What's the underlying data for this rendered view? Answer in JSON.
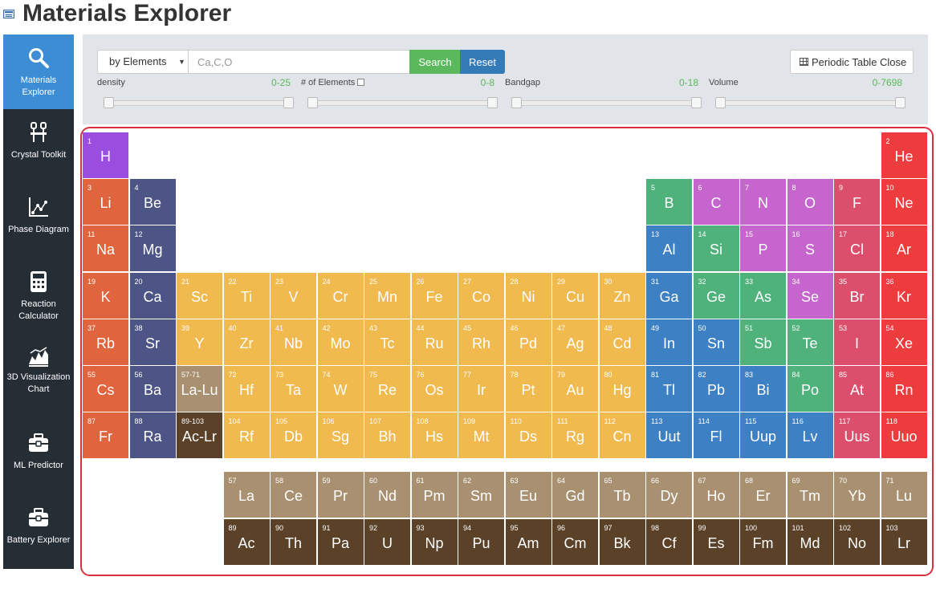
{
  "header": {
    "title": "Materials Explorer"
  },
  "sidebar": {
    "items": [
      {
        "label": "Materials Explorer",
        "icon": "search-icon",
        "active": true
      },
      {
        "label": "Crystal Toolkit",
        "icon": "toolkit-icon"
      },
      {
        "label": "Phase Diagram",
        "icon": "phase-diagram-icon"
      },
      {
        "label": "Reaction Calculator",
        "icon": "calculator-icon"
      },
      {
        "label": "3D Visualization Chart",
        "icon": "3d-chart-icon"
      },
      {
        "label": "ML Predictor",
        "icon": "toolbox-icon"
      },
      {
        "label": "Battery Explorer",
        "icon": "battery-toolbox-icon"
      }
    ]
  },
  "search": {
    "mode": "by Elements",
    "placeholder": "Ca,C,O",
    "value": "",
    "search_label": "Search",
    "reset_label": "Reset",
    "toggle_label": "Periodic Table Close"
  },
  "filters": [
    {
      "label": "density",
      "range": "0-25"
    },
    {
      "label": "# of Elements",
      "range": "0-8",
      "checkbox": true
    },
    {
      "label": "Bandgap",
      "range": "0-18"
    },
    {
      "label": "Volume",
      "range": "0-7698"
    }
  ],
  "colors": {
    "alkali": "#e0643e",
    "alkaline": "#4d5586",
    "transition": "#f0ba4f",
    "post_transition": "#3d80c4",
    "metalloid": "#4fb27b",
    "nonmetal": "#c665cd",
    "halogen": "#dc4f6c",
    "noble": "#ec3c3d",
    "hydrogen": "#9b4de0",
    "lanthanide": "#a99071",
    "actinide": "#5a4128"
  },
  "periodic_table": [
    {
      "n": "1",
      "s": "H",
      "c": "hydrogen",
      "r": 0,
      "k": 0
    },
    {
      "n": "2",
      "s": "He",
      "c": "noble",
      "r": 0,
      "k": 17
    },
    {
      "n": "3",
      "s": "Li",
      "c": "alkali",
      "r": 1,
      "k": 0
    },
    {
      "n": "4",
      "s": "Be",
      "c": "alkaline",
      "r": 1,
      "k": 1
    },
    {
      "n": "5",
      "s": "B",
      "c": "metalloid",
      "r": 1,
      "k": 12
    },
    {
      "n": "6",
      "s": "C",
      "c": "nonmetal",
      "r": 1,
      "k": 13
    },
    {
      "n": "7",
      "s": "N",
      "c": "nonmetal",
      "r": 1,
      "k": 14
    },
    {
      "n": "8",
      "s": "O",
      "c": "nonmetal",
      "r": 1,
      "k": 15
    },
    {
      "n": "9",
      "s": "F",
      "c": "halogen",
      "r": 1,
      "k": 16
    },
    {
      "n": "10",
      "s": "Ne",
      "c": "noble",
      "r": 1,
      "k": 17
    },
    {
      "n": "11",
      "s": "Na",
      "c": "alkali",
      "r": 2,
      "k": 0
    },
    {
      "n": "12",
      "s": "Mg",
      "c": "alkaline",
      "r": 2,
      "k": 1
    },
    {
      "n": "13",
      "s": "Al",
      "c": "post_transition",
      "r": 2,
      "k": 12
    },
    {
      "n": "14",
      "s": "Si",
      "c": "metalloid",
      "r": 2,
      "k": 13
    },
    {
      "n": "15",
      "s": "P",
      "c": "nonmetal",
      "r": 2,
      "k": 14
    },
    {
      "n": "16",
      "s": "S",
      "c": "nonmetal",
      "r": 2,
      "k": 15
    },
    {
      "n": "17",
      "s": "Cl",
      "c": "halogen",
      "r": 2,
      "k": 16
    },
    {
      "n": "18",
      "s": "Ar",
      "c": "noble",
      "r": 2,
      "k": 17
    },
    {
      "n": "19",
      "s": "K",
      "c": "alkali",
      "r": 3,
      "k": 0
    },
    {
      "n": "20",
      "s": "Ca",
      "c": "alkaline",
      "r": 3,
      "k": 1
    },
    {
      "n": "21",
      "s": "Sc",
      "c": "transition",
      "r": 3,
      "k": 2
    },
    {
      "n": "22",
      "s": "Ti",
      "c": "transition",
      "r": 3,
      "k": 3
    },
    {
      "n": "23",
      "s": "V",
      "c": "transition",
      "r": 3,
      "k": 4
    },
    {
      "n": "24",
      "s": "Cr",
      "c": "transition",
      "r": 3,
      "k": 5
    },
    {
      "n": "25",
      "s": "Mn",
      "c": "transition",
      "r": 3,
      "k": 6
    },
    {
      "n": "26",
      "s": "Fe",
      "c": "transition",
      "r": 3,
      "k": 7
    },
    {
      "n": "27",
      "s": "Co",
      "c": "transition",
      "r": 3,
      "k": 8
    },
    {
      "n": "28",
      "s": "Ni",
      "c": "transition",
      "r": 3,
      "k": 9
    },
    {
      "n": "29",
      "s": "Cu",
      "c": "transition",
      "r": 3,
      "k": 10
    },
    {
      "n": "30",
      "s": "Zn",
      "c": "transition",
      "r": 3,
      "k": 11
    },
    {
      "n": "31",
      "s": "Ga",
      "c": "post_transition",
      "r": 3,
      "k": 12
    },
    {
      "n": "32",
      "s": "Ge",
      "c": "metalloid",
      "r": 3,
      "k": 13
    },
    {
      "n": "33",
      "s": "As",
      "c": "metalloid",
      "r": 3,
      "k": 14
    },
    {
      "n": "34",
      "s": "Se",
      "c": "nonmetal",
      "r": 3,
      "k": 15
    },
    {
      "n": "35",
      "s": "Br",
      "c": "halogen",
      "r": 3,
      "k": 16
    },
    {
      "n": "36",
      "s": "Kr",
      "c": "noble",
      "r": 3,
      "k": 17
    },
    {
      "n": "37",
      "s": "Rb",
      "c": "alkali",
      "r": 4,
      "k": 0
    },
    {
      "n": "38",
      "s": "Sr",
      "c": "alkaline",
      "r": 4,
      "k": 1
    },
    {
      "n": "39",
      "s": "Y",
      "c": "transition",
      "r": 4,
      "k": 2
    },
    {
      "n": "40",
      "s": "Zr",
      "c": "transition",
      "r": 4,
      "k": 3
    },
    {
      "n": "41",
      "s": "Nb",
      "c": "transition",
      "r": 4,
      "k": 4
    },
    {
      "n": "42",
      "s": "Mo",
      "c": "transition",
      "r": 4,
      "k": 5
    },
    {
      "n": "43",
      "s": "Tc",
      "c": "transition",
      "r": 4,
      "k": 6
    },
    {
      "n": "44",
      "s": "Ru",
      "c": "transition",
      "r": 4,
      "k": 7
    },
    {
      "n": "45",
      "s": "Rh",
      "c": "transition",
      "r": 4,
      "k": 8
    },
    {
      "n": "46",
      "s": "Pd",
      "c": "transition",
      "r": 4,
      "k": 9
    },
    {
      "n": "47",
      "s": "Ag",
      "c": "transition",
      "r": 4,
      "k": 10
    },
    {
      "n": "48",
      "s": "Cd",
      "c": "transition",
      "r": 4,
      "k": 11
    },
    {
      "n": "49",
      "s": "In",
      "c": "post_transition",
      "r": 4,
      "k": 12
    },
    {
      "n": "50",
      "s": "Sn",
      "c": "post_transition",
      "r": 4,
      "k": 13
    },
    {
      "n": "51",
      "s": "Sb",
      "c": "metalloid",
      "r": 4,
      "k": 14
    },
    {
      "n": "52",
      "s": "Te",
      "c": "metalloid",
      "r": 4,
      "k": 15
    },
    {
      "n": "53",
      "s": "I",
      "c": "halogen",
      "r": 4,
      "k": 16
    },
    {
      "n": "54",
      "s": "Xe",
      "c": "noble",
      "r": 4,
      "k": 17
    },
    {
      "n": "55",
      "s": "Cs",
      "c": "alkali",
      "r": 5,
      "k": 0
    },
    {
      "n": "56",
      "s": "Ba",
      "c": "alkaline",
      "r": 5,
      "k": 1
    },
    {
      "n": "57-71",
      "s": "La-Lu",
      "c": "lanthanide",
      "r": 5,
      "k": 2
    },
    {
      "n": "72",
      "s": "Hf",
      "c": "transition",
      "r": 5,
      "k": 3
    },
    {
      "n": "73",
      "s": "Ta",
      "c": "transition",
      "r": 5,
      "k": 4
    },
    {
      "n": "74",
      "s": "W",
      "c": "transition",
      "r": 5,
      "k": 5
    },
    {
      "n": "75",
      "s": "Re",
      "c": "transition",
      "r": 5,
      "k": 6
    },
    {
      "n": "76",
      "s": "Os",
      "c": "transition",
      "r": 5,
      "k": 7
    },
    {
      "n": "77",
      "s": "Ir",
      "c": "transition",
      "r": 5,
      "k": 8
    },
    {
      "n": "78",
      "s": "Pt",
      "c": "transition",
      "r": 5,
      "k": 9
    },
    {
      "n": "79",
      "s": "Au",
      "c": "transition",
      "r": 5,
      "k": 10
    },
    {
      "n": "80",
      "s": "Hg",
      "c": "transition",
      "r": 5,
      "k": 11
    },
    {
      "n": "81",
      "s": "Tl",
      "c": "post_transition",
      "r": 5,
      "k": 12
    },
    {
      "n": "82",
      "s": "Pb",
      "c": "post_transition",
      "r": 5,
      "k": 13
    },
    {
      "n": "83",
      "s": "Bi",
      "c": "post_transition",
      "r": 5,
      "k": 14
    },
    {
      "n": "84",
      "s": "Po",
      "c": "metalloid",
      "r": 5,
      "k": 15
    },
    {
      "n": "85",
      "s": "At",
      "c": "halogen",
      "r": 5,
      "k": 16
    },
    {
      "n": "86",
      "s": "Rn",
      "c": "noble",
      "r": 5,
      "k": 17
    },
    {
      "n": "87",
      "s": "Fr",
      "c": "alkali",
      "r": 6,
      "k": 0
    },
    {
      "n": "88",
      "s": "Ra",
      "c": "alkaline",
      "r": 6,
      "k": 1
    },
    {
      "n": "89-103",
      "s": "Ac-Lr",
      "c": "actinide",
      "r": 6,
      "k": 2
    },
    {
      "n": "104",
      "s": "Rf",
      "c": "transition",
      "r": 6,
      "k": 3
    },
    {
      "n": "105",
      "s": "Db",
      "c": "transition",
      "r": 6,
      "k": 4
    },
    {
      "n": "106",
      "s": "Sg",
      "c": "transition",
      "r": 6,
      "k": 5
    },
    {
      "n": "107",
      "s": "Bh",
      "c": "transition",
      "r": 6,
      "k": 6
    },
    {
      "n": "108",
      "s": "Hs",
      "c": "transition",
      "r": 6,
      "k": 7
    },
    {
      "n": "109",
      "s": "Mt",
      "c": "transition",
      "r": 6,
      "k": 8
    },
    {
      "n": "110",
      "s": "Ds",
      "c": "transition",
      "r": 6,
      "k": 9
    },
    {
      "n": "111",
      "s": "Rg",
      "c": "transition",
      "r": 6,
      "k": 10
    },
    {
      "n": "112",
      "s": "Cn",
      "c": "transition",
      "r": 6,
      "k": 11
    },
    {
      "n": "113",
      "s": "Uut",
      "c": "post_transition",
      "r": 6,
      "k": 12
    },
    {
      "n": "114",
      "s": "Fl",
      "c": "post_transition",
      "r": 6,
      "k": 13
    },
    {
      "n": "115",
      "s": "Uup",
      "c": "post_transition",
      "r": 6,
      "k": 14
    },
    {
      "n": "116",
      "s": "Lv",
      "c": "post_transition",
      "r": 6,
      "k": 15
    },
    {
      "n": "117",
      "s": "Uus",
      "c": "halogen",
      "r": 6,
      "k": 16
    },
    {
      "n": "118",
      "s": "Uuo",
      "c": "noble",
      "r": 6,
      "k": 17
    },
    {
      "n": "57",
      "s": "La",
      "c": "lanthanide",
      "r": 7,
      "k": 3
    },
    {
      "n": "58",
      "s": "Ce",
      "c": "lanthanide",
      "r": 7,
      "k": 4
    },
    {
      "n": "59",
      "s": "Pr",
      "c": "lanthanide",
      "r": 7,
      "k": 5
    },
    {
      "n": "60",
      "s": "Nd",
      "c": "lanthanide",
      "r": 7,
      "k": 6
    },
    {
      "n": "61",
      "s": "Pm",
      "c": "lanthanide",
      "r": 7,
      "k": 7
    },
    {
      "n": "62",
      "s": "Sm",
      "c": "lanthanide",
      "r": 7,
      "k": 8
    },
    {
      "n": "63",
      "s": "Eu",
      "c": "lanthanide",
      "r": 7,
      "k": 9
    },
    {
      "n": "64",
      "s": "Gd",
      "c": "lanthanide",
      "r": 7,
      "k": 10
    },
    {
      "n": "65",
      "s": "Tb",
      "c": "lanthanide",
      "r": 7,
      "k": 11
    },
    {
      "n": "66",
      "s": "Dy",
      "c": "lanthanide",
      "r": 7,
      "k": 12
    },
    {
      "n": "67",
      "s": "Ho",
      "c": "lanthanide",
      "r": 7,
      "k": 13
    },
    {
      "n": "68",
      "s": "Er",
      "c": "lanthanide",
      "r": 7,
      "k": 14
    },
    {
      "n": "69",
      "s": "Tm",
      "c": "lanthanide",
      "r": 7,
      "k": 15
    },
    {
      "n": "70",
      "s": "Yb",
      "c": "lanthanide",
      "r": 7,
      "k": 16
    },
    {
      "n": "71",
      "s": "Lu",
      "c": "lanthanide",
      "r": 7,
      "k": 17
    },
    {
      "n": "89",
      "s": "Ac",
      "c": "actinide",
      "r": 8,
      "k": 3
    },
    {
      "n": "90",
      "s": "Th",
      "c": "actinide",
      "r": 8,
      "k": 4
    },
    {
      "n": "91",
      "s": "Pa",
      "c": "actinide",
      "r": 8,
      "k": 5
    },
    {
      "n": "92",
      "s": "U",
      "c": "actinide",
      "r": 8,
      "k": 6
    },
    {
      "n": "93",
      "s": "Np",
      "c": "actinide",
      "r": 8,
      "k": 7
    },
    {
      "n": "94",
      "s": "Pu",
      "c": "actinide",
      "r": 8,
      "k": 8
    },
    {
      "n": "95",
      "s": "Am",
      "c": "actinide",
      "r": 8,
      "k": 9
    },
    {
      "n": "96",
      "s": "Cm",
      "c": "actinide",
      "r": 8,
      "k": 10
    },
    {
      "n": "97",
      "s": "Bk",
      "c": "actinide",
      "r": 8,
      "k": 11
    },
    {
      "n": "98",
      "s": "Cf",
      "c": "actinide",
      "r": 8,
      "k": 12
    },
    {
      "n": "99",
      "s": "Es",
      "c": "actinide",
      "r": 8,
      "k": 13
    },
    {
      "n": "100",
      "s": "Fm",
      "c": "actinide",
      "r": 8,
      "k": 14
    },
    {
      "n": "101",
      "s": "Md",
      "c": "actinide",
      "r": 8,
      "k": 15
    },
    {
      "n": "102",
      "s": "No",
      "c": "actinide",
      "r": 8,
      "k": 16
    },
    {
      "n": "103",
      "s": "Lr",
      "c": "actinide",
      "r": 8,
      "k": 17
    }
  ]
}
